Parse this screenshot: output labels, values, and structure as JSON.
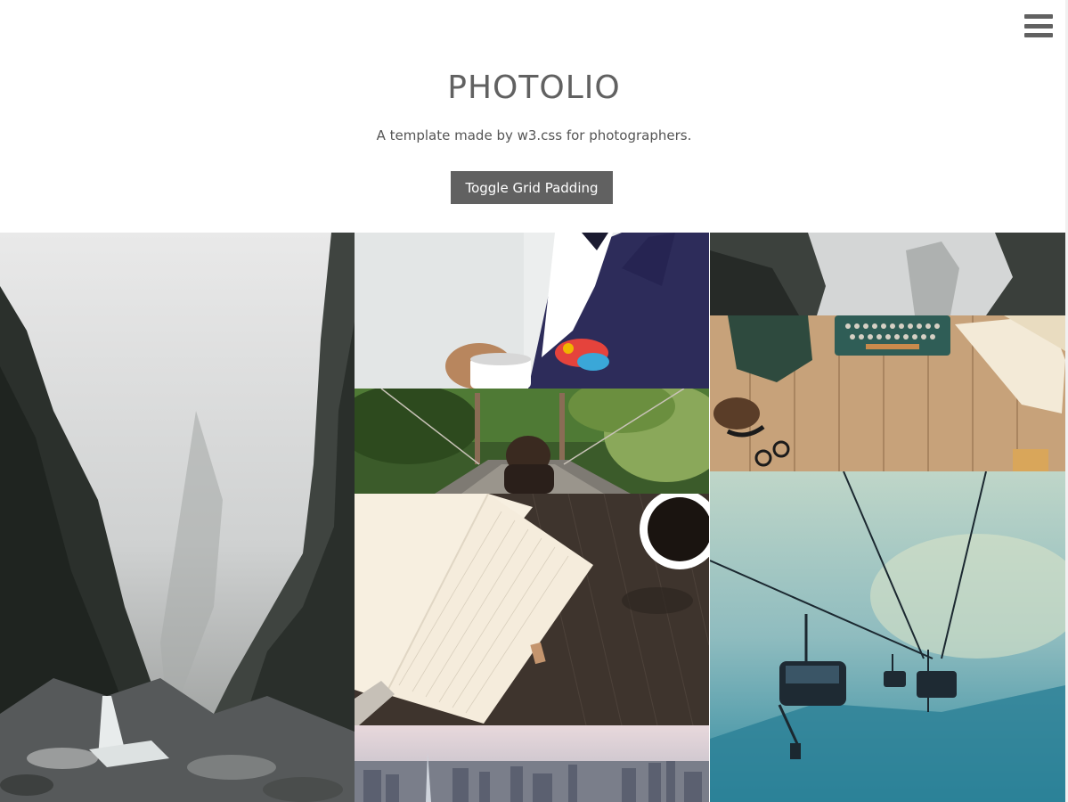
{
  "header": {
    "title": "PHOTOLIO",
    "subtitle": "A template made by w3.css for photographers.",
    "toggle_label": "Toggle Grid Padding"
  },
  "menu": {
    "icon": "hamburger-menu-icon"
  },
  "photos": [
    {
      "name": "photo-misty-canyon",
      "column": 1
    },
    {
      "name": "photo-man-coffee-suit",
      "column": 2
    },
    {
      "name": "photo-woman-on-bridge",
      "column": 2
    },
    {
      "name": "photo-notebook-coffee",
      "column": 2
    },
    {
      "name": "photo-city-skyline",
      "column": 2
    },
    {
      "name": "photo-foggy-cliffs",
      "column": 3
    },
    {
      "name": "photo-typewriter-desk",
      "column": 3
    },
    {
      "name": "photo-ski-lift",
      "column": 3
    }
  ],
  "colors": {
    "accent": "#616161",
    "background": "#ffffff"
  }
}
